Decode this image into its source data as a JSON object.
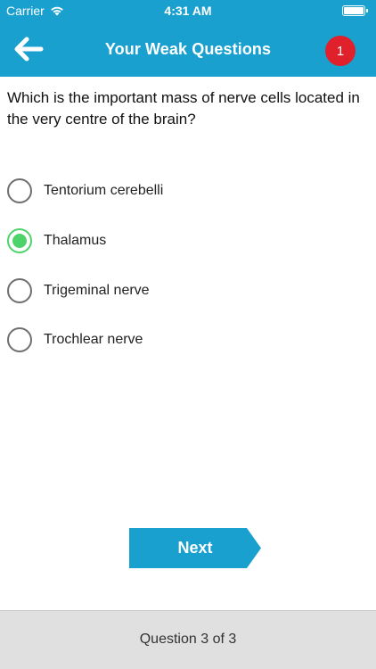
{
  "status_bar": {
    "carrier": "Carrier",
    "time": "4:31 AM",
    "wifi_icon": "wifi-icon",
    "battery_icon": "battery-icon"
  },
  "nav": {
    "back_icon": "back-arrow-icon",
    "title": "Your Weak Questions",
    "badge_count": "1"
  },
  "question": {
    "text": "Which is the important mass of nerve cells located in the very centre of the brain?"
  },
  "options": [
    {
      "label": "Tentorium cerebelli",
      "selected": false
    },
    {
      "label": "Thalamus",
      "selected": true
    },
    {
      "label": "Trigeminal nerve",
      "selected": false
    },
    {
      "label": "Trochlear nerve",
      "selected": false
    }
  ],
  "next_button": {
    "label": "Next"
  },
  "footer": {
    "progress_text": "Question 3 of 3"
  },
  "colors": {
    "accent": "#1aa0cf",
    "badge": "#e0202a",
    "selected_radio": "#4ed36a",
    "footer_bg": "#e0e0e0"
  }
}
